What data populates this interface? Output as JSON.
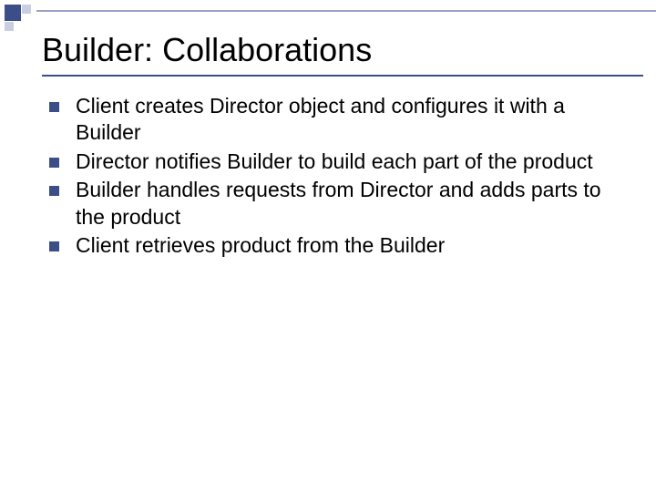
{
  "slide": {
    "title": "Builder: Collaborations",
    "bullets": [
      "Client creates Director object and configures it with a Builder",
      "Director notifies Builder to build each part of the product",
      "Builder handles requests from Director and adds parts to the product",
      "Client retrieves product from the Builder"
    ]
  },
  "colors": {
    "accent": "#3b4e87",
    "light_accent": "#c9cfe0",
    "underline": "#3b4e87",
    "top_line": "#9aa3c4"
  }
}
